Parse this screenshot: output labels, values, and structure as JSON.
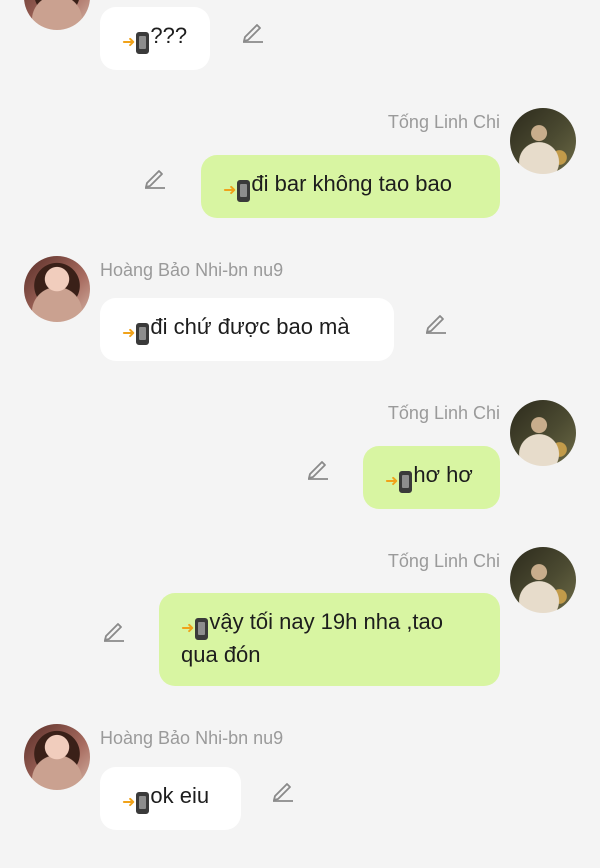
{
  "messages": [
    {
      "side": "left",
      "text": "???"
    },
    {
      "side": "right",
      "sender": "Tống Linh Chi",
      "text": "đi bar không tao bao"
    },
    {
      "side": "left",
      "sender": "Hoàng Bảo Nhi-bn nu9",
      "text": "đi chứ được bao mà"
    },
    {
      "side": "right",
      "sender": "Tống Linh Chi",
      "text": "hơ hơ"
    },
    {
      "side": "right",
      "sender": "Tống Linh Chi",
      "text": "vậy tối nay 19h nha ,tao qua đón"
    },
    {
      "side": "left",
      "sender": "Hoàng Bảo Nhi-bn nu9",
      "text": "ok eiu"
    }
  ],
  "icons": {
    "message_prefix": [
      "arrow-right-icon",
      "mobile-phone-icon"
    ],
    "edit": "pencil-icon"
  },
  "colors": {
    "background": "#f4f4f4",
    "incoming_bubble": "#ffffff",
    "outgoing_bubble": "#d8f5a2",
    "sender_name": "#9a9a9a",
    "arrow": "#f0a21a"
  }
}
